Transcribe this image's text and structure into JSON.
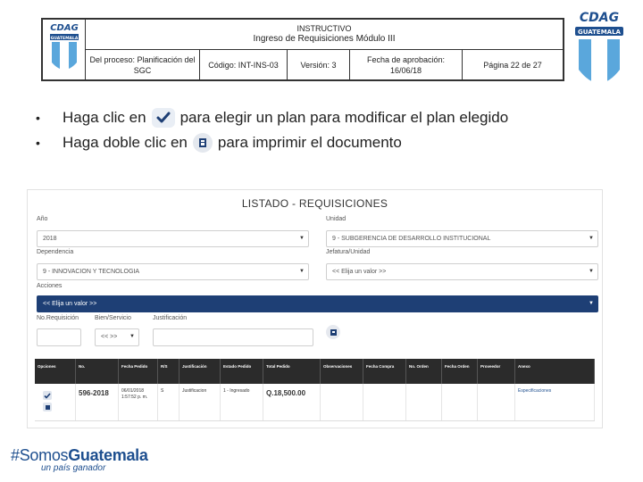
{
  "header": {
    "line1": "INSTRUCTIVO",
    "line2": "Ingreso de Requisiciones Módulo III",
    "process": "Del proceso: Planificación del SGC",
    "code": "Código: INT-INS-03",
    "version": "Versión: 3",
    "approval": "Fecha de aprobación: 16/06/18",
    "page": "Página 22 de 27",
    "logo_text": "CDAG",
    "logo_band": "GUATEMALA"
  },
  "bullets": [
    {
      "before": "Haga clic en",
      "icon": "check-icon",
      "after": "para elegir un plan para modificar el plan elegido"
    },
    {
      "before": "Haga doble clic en",
      "icon": "print-icon",
      "after": "para imprimir el documento"
    }
  ],
  "app": {
    "title": "LISTADO - REQUISICIONES",
    "labels": {
      "year": "Año",
      "unit": "Unidad",
      "dependency": "Dependencia",
      "jefatura": "Jefatura/Unidad",
      "actions": "Acciones",
      "req_no": "No.Requisición",
      "good": "Bien/Servicio",
      "justification": "Justificación"
    },
    "values": {
      "year": "2018",
      "unit": "9 - SUBGERENCIA DE DESARROLLO INSTITUCIONAL",
      "dependency": "9 - INNOVACION Y TECNOLOGIA",
      "jefatura": "<< Elija un valor >>",
      "actions": "<< Elija un valor >>",
      "good": "<< >>"
    },
    "table": {
      "headers": [
        "Opciones",
        "No.",
        "Fecha Pedido",
        "R/S",
        "Justificación",
        "Estado Pedido",
        "Total Pedido",
        "Observaciones",
        "Fecha Compra",
        "No. Orden",
        "Fecha Orden",
        "Proveedor",
        "Anexo"
      ],
      "row": {
        "no": "596-2018",
        "date": "06/01/2018 1:57:52 p. m.",
        "rs": "S",
        "justification": "Justificacion",
        "status": "1 - Ingresado",
        "total": "Q.18,500.00",
        "spec": "Especificaciones"
      }
    }
  },
  "footer": {
    "slogan_prefix": "#Somos",
    "slogan_bold": "Guatemala",
    "slogan_sub": "un país ganador"
  },
  "colors": {
    "brand": "#1e4f8f",
    "dark_header": "#2b2b2b",
    "select_dark": "#1e3f75"
  }
}
